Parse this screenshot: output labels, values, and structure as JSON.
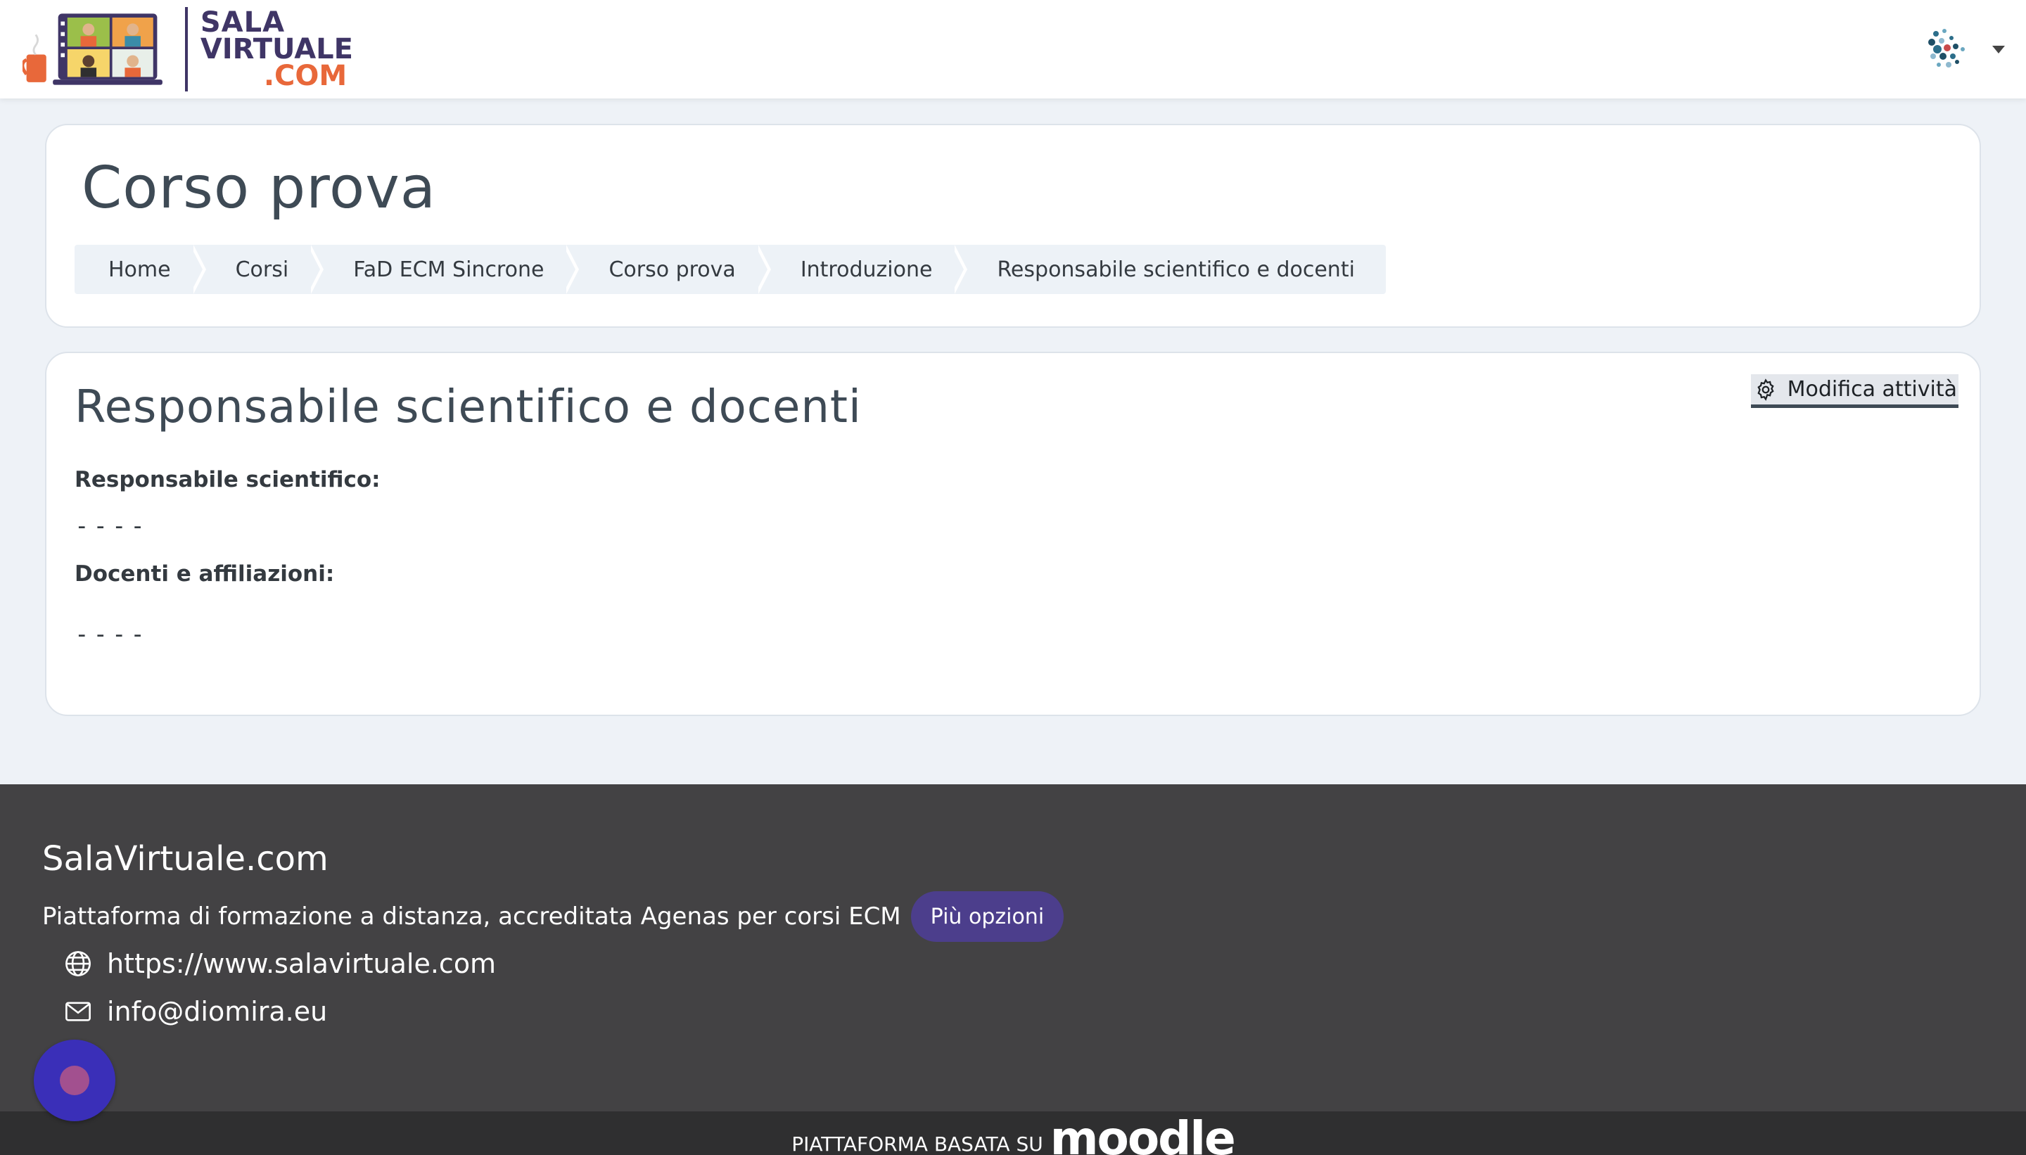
{
  "brand": {
    "logo_line1": "SALA",
    "logo_line2": "VIRTUALE",
    "logo_line3": ".COM",
    "colors": {
      "primary": "#3f3566",
      "accent": "#e8683a"
    }
  },
  "header": {
    "user_menu_icon": "avatar-icon",
    "caret_icon": "caret-down-icon"
  },
  "page": {
    "title": "Corso prova",
    "breadcrumb": [
      {
        "label": "Home"
      },
      {
        "label": "Corsi"
      },
      {
        "label": "FaD ECM Sincrone"
      },
      {
        "label": "Corso prova"
      },
      {
        "label": "Introduzione"
      },
      {
        "label": "Responsabile scientifico e docenti"
      }
    ]
  },
  "activity": {
    "title": "Responsabile scientifico e docenti",
    "edit_label": "Modifica attività",
    "fields": [
      {
        "label": "Responsabile scientifico:",
        "value": "----"
      },
      {
        "label": "Docenti e affiliazioni:",
        "value": "----"
      }
    ]
  },
  "footer": {
    "title": "SalaVirtuale.com",
    "description": "Piattaforma di formazione a distanza, accreditata Agenas per corsi ECM",
    "more_button": "Più opzioni",
    "website": "https://www.salavirtuale.com",
    "email": "info@diomira.eu",
    "powered_by": "PIATTAFORMA BASATA SU",
    "moodle": "moodle",
    "colors": {
      "background": "#434244",
      "button": "#4c3e8c"
    }
  }
}
